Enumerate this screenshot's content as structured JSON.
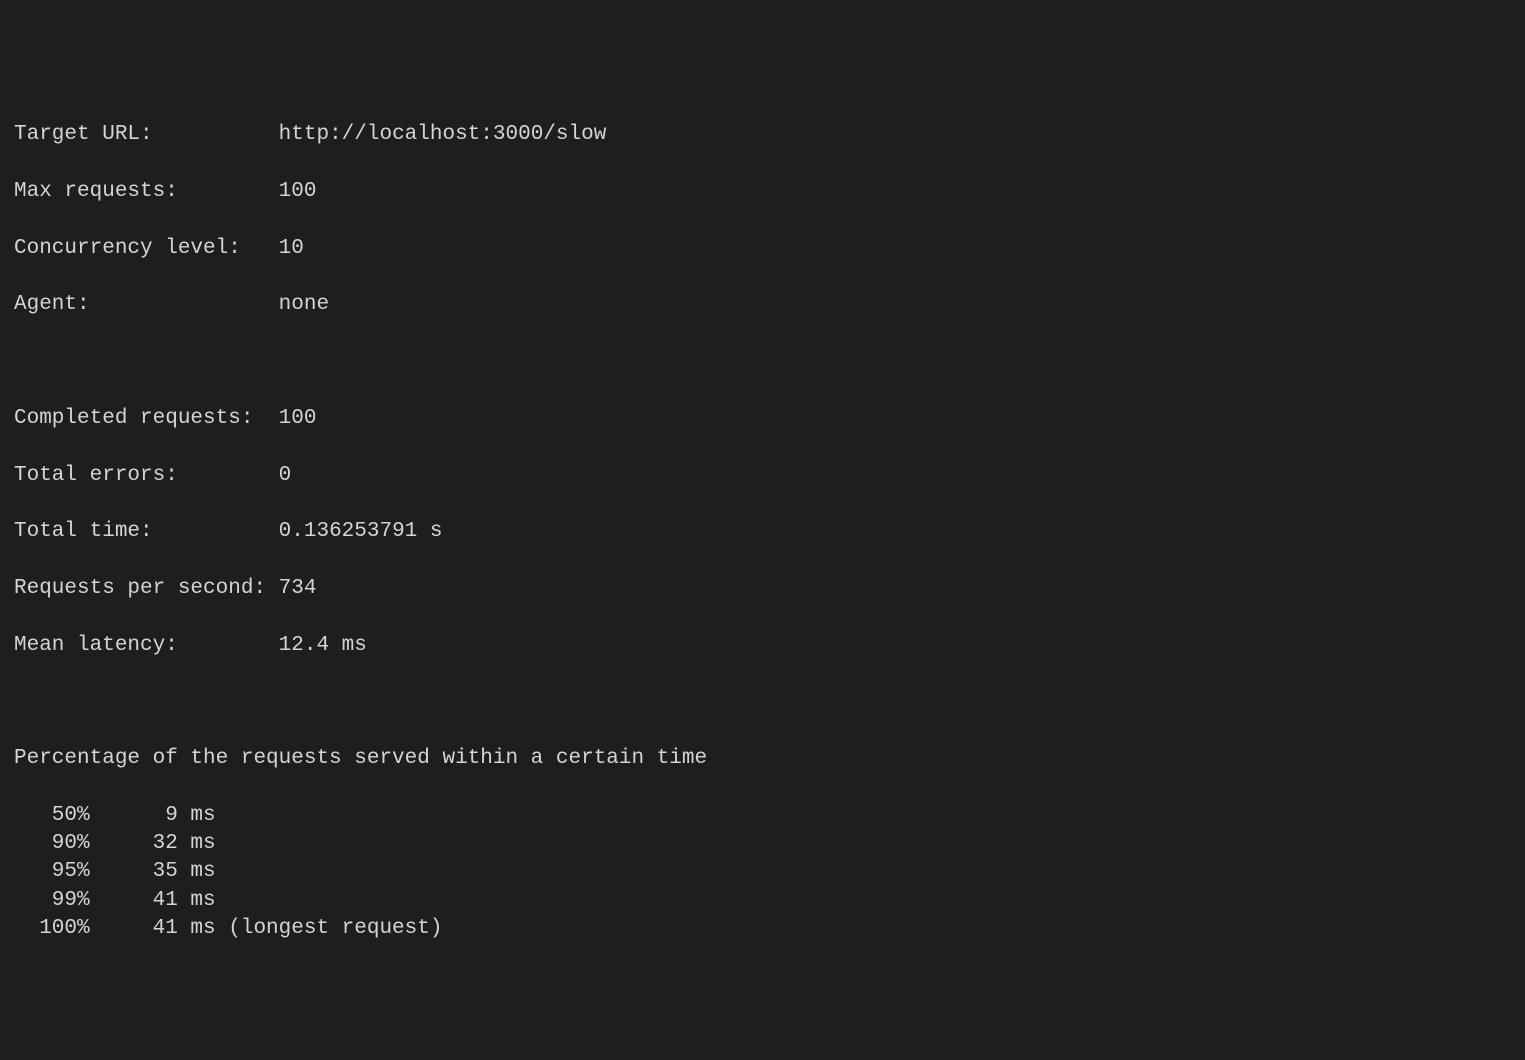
{
  "config": {
    "target_url_label": "Target URL:",
    "target_url_value": "http://localhost:3000/slow",
    "max_requests_label": "Max requests:",
    "max_requests_value": "100",
    "concurrency_label": "Concurrency level:",
    "concurrency_value": "10",
    "agent_label": "Agent:",
    "agent_value": "none"
  },
  "results": {
    "completed_label": "Completed requests:",
    "completed_value": "100",
    "errors_label": "Total errors:",
    "errors_value": "0",
    "total_time_label": "Total time:",
    "total_time_value": "0.136253791 s",
    "rps_label": "Requests per second:",
    "rps_value": "734",
    "mean_latency_label": "Mean latency:",
    "mean_latency_value": "12.4 ms"
  },
  "percentiles": {
    "header": "Percentage of the requests served within a certain time",
    "rows": [
      {
        "pct": "50%",
        "val": "9 ms",
        "note": ""
      },
      {
        "pct": "90%",
        "val": "32 ms",
        "note": ""
      },
      {
        "pct": "95%",
        "val": "35 ms",
        "note": ""
      },
      {
        "pct": "99%",
        "val": "41 ms",
        "note": ""
      },
      {
        "pct": "100%",
        "val": "41 ms",
        "note": "(longest request)"
      }
    ]
  }
}
